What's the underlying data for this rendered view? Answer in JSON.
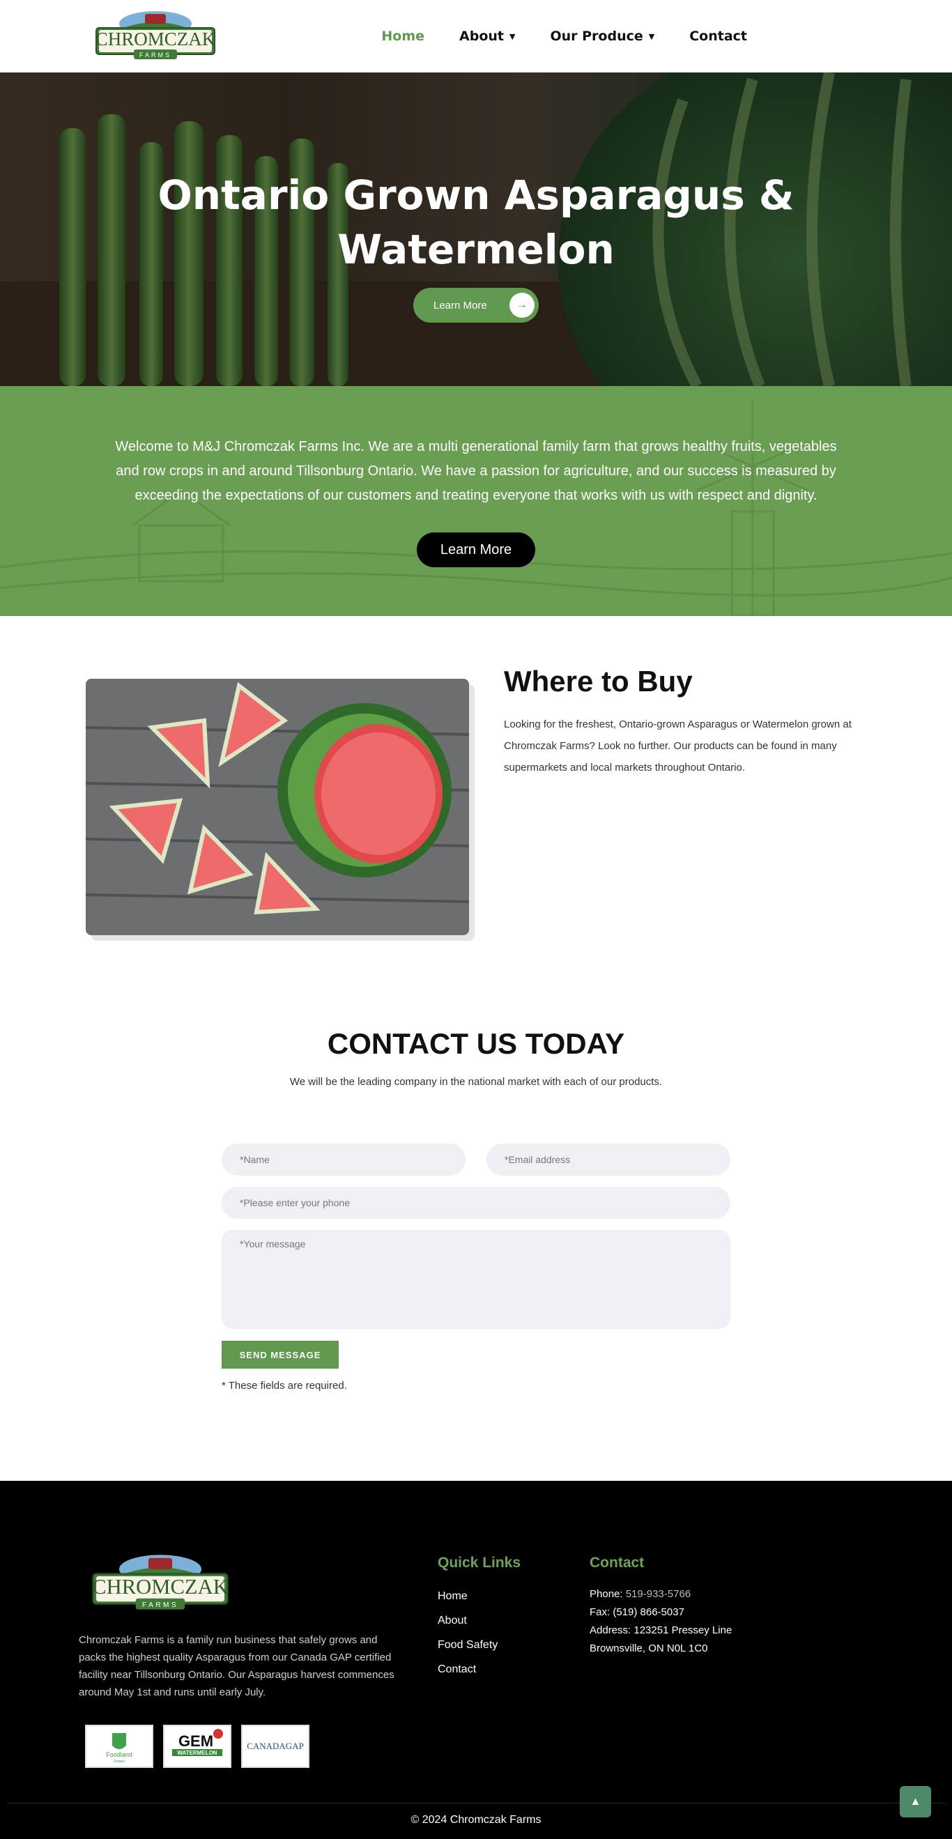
{
  "brand": {
    "logo_text": "CHROMCZAK",
    "logo_sub": "FARMS",
    "green": "#5f9a4e",
    "dark_green": "#4e8a67"
  },
  "nav": {
    "items": [
      {
        "label": "Home",
        "active": true,
        "dropdown": false
      },
      {
        "label": "About",
        "active": false,
        "dropdown": true
      },
      {
        "label": "Our Produce",
        "active": false,
        "dropdown": true
      },
      {
        "label": "Contact",
        "active": false,
        "dropdown": false
      }
    ]
  },
  "hero": {
    "title": "Ontario Grown Asparagus & Watermelon",
    "button_label": "Learn More",
    "button_icon": "arrow-right-icon"
  },
  "welcome": {
    "text": "Welcome to M&J Chromczak Farms Inc.  We are a multi generational family farm that grows healthy fruits, vegetables and row crops in and around Tillsonburg Ontario.  We have a passion for agriculture, and our success is measured by exceeding the expectations of our customers and treating everyone that works with us with respect and dignity.",
    "button_label": "Learn More"
  },
  "where_to_buy": {
    "title": "Where to Buy",
    "text": "Looking for the freshest, Ontario-grown Asparagus or Watermelon grown at Chromczak Farms? Look no further. Our products can be found in many supermarkets and local markets throughout Ontario."
  },
  "contact": {
    "title": "CONTACT US TODAY",
    "subtitle": "We will be the leading company in the national market with each of our products.",
    "name_placeholder": "*Name",
    "email_placeholder": "*Email address",
    "phone_placeholder": "*Please enter your phone",
    "message_placeholder": "*Your message",
    "send_label": "SEND MESSAGE",
    "required_note": "* These fields are required."
  },
  "footer": {
    "about": "Chromczak Farms is a family run business that safely grows and packs the highest quality Asparagus from our Canada GAP certified facility near Tillsonburg Ontario. Our Asparagus harvest commences around May 1st and runs until early July.",
    "badges": [
      {
        "label": "Foodland",
        "sub": "Ontario"
      },
      {
        "label": "GEM",
        "sub": "WATERMELON"
      },
      {
        "label": "CANADAGAP",
        "sub": ""
      }
    ],
    "quick_links_title": "Quick Links",
    "quick_links": [
      "Home",
      "About",
      "Food Safety",
      "Contact"
    ],
    "contact_title": "Contact",
    "phone_label": "Phone:",
    "phone": "519-933-5766",
    "fax": "Fax: (519) 866-5037",
    "address_1": "Address: 123251 Pressey Line",
    "address_2": "Brownsville, ON N0L 1C0",
    "copyright": "© 2024 Chromczak Farms",
    "to_top_icon": "chevron-up-icon"
  }
}
